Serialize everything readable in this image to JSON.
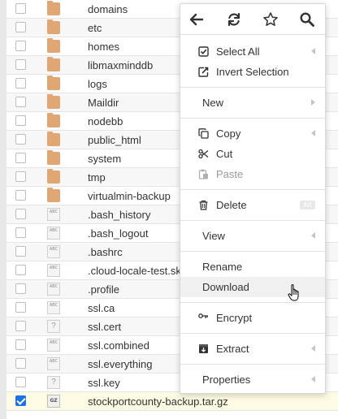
{
  "files": [
    {
      "name": "domains",
      "type": "folder",
      "checked": false
    },
    {
      "name": "etc",
      "type": "folder",
      "checked": false
    },
    {
      "name": "homes",
      "type": "folder",
      "checked": false
    },
    {
      "name": "libmaxminddb",
      "type": "folder",
      "checked": false
    },
    {
      "name": "logs",
      "type": "folder",
      "checked": false
    },
    {
      "name": "Maildir",
      "type": "folder",
      "checked": false
    },
    {
      "name": "nodebb",
      "type": "folder",
      "checked": false
    },
    {
      "name": "public_html",
      "type": "folder",
      "checked": false
    },
    {
      "name": "system",
      "type": "folder",
      "checked": false
    },
    {
      "name": "tmp",
      "type": "folder",
      "checked": false
    },
    {
      "name": "virtualmin-backup",
      "type": "folder",
      "checked": false
    },
    {
      "name": ".bash_history",
      "type": "text",
      "checked": false
    },
    {
      "name": ".bash_logout",
      "type": "text",
      "checked": false
    },
    {
      "name": ".bashrc",
      "type": "text",
      "checked": false
    },
    {
      "name": ".cloud-locale-test.skip",
      "type": "text",
      "checked": false
    },
    {
      "name": ".profile",
      "type": "text",
      "checked": false
    },
    {
      "name": "ssl.ca",
      "type": "text",
      "checked": false
    },
    {
      "name": "ssl.cert",
      "type": "unknown",
      "checked": false
    },
    {
      "name": "ssl.combined",
      "type": "text",
      "checked": false
    },
    {
      "name": "ssl.everything",
      "type": "text",
      "checked": false
    },
    {
      "name": "ssl.key",
      "type": "unknown",
      "checked": false
    },
    {
      "name": "stockportcounty-backup.tar.gz",
      "type": "archive",
      "checked": true
    }
  ],
  "icon_text": {
    "text_file": "ABC",
    "archive": "GZ",
    "unknown": "?"
  },
  "menu": {
    "toolbar": [
      "back-arrow-icon",
      "refresh-icon",
      "star-icon",
      "search-icon"
    ],
    "select_all": "Select All",
    "invert_selection": "Invert Selection",
    "new": "New",
    "copy": "Copy",
    "cut": "Cut",
    "paste": "Paste",
    "delete": "Delete",
    "delete_shortcut": "Alt",
    "view": "View",
    "rename": "Rename",
    "download": "Download",
    "encrypt": "Encrypt",
    "extract": "Extract",
    "properties": "Properties"
  },
  "colors": {
    "folder": "#e0a674",
    "checkbox_checked": "#1a73e8",
    "selected_row": "#fdfbe3"
  }
}
